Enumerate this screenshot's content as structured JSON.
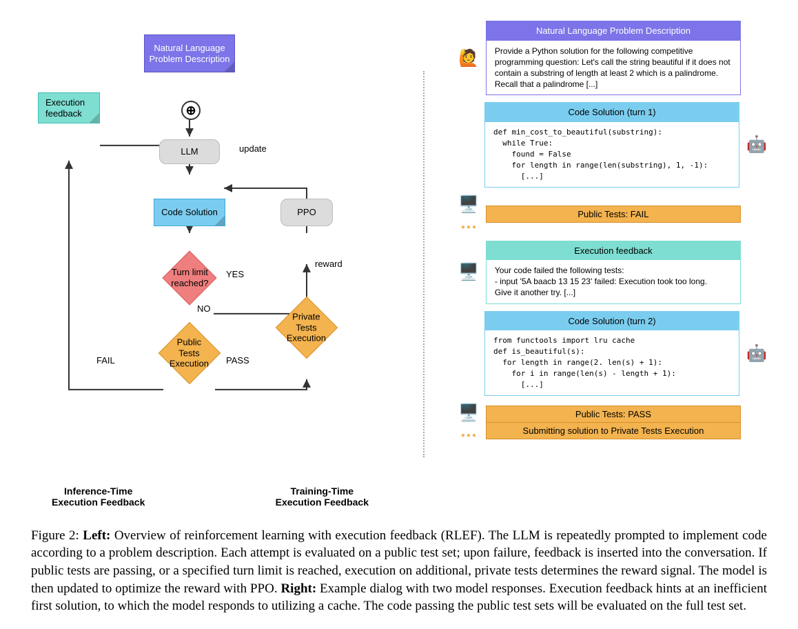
{
  "diagram": {
    "nodes": {
      "problem": "Natural Language\nProblem Description",
      "exec_feedback": "Execution\nfeedback",
      "llm": "LLM",
      "code_solution": "Code Solution",
      "ppo": "PPO",
      "turn_limit": "Turn limit\nreached?",
      "public_tests": "Public Tests\nExecution",
      "private_tests": "Private Tests\nExecution"
    },
    "edge_labels": {
      "update": "update",
      "yes": "YES",
      "no": "NO",
      "pass": "PASS",
      "fail": "FAIL",
      "reward": "reward"
    },
    "bottom": {
      "left": "Inference-Time\nExecution Feedback",
      "right": "Training-Time\nExecution Feedback"
    }
  },
  "dialog": {
    "problem_head": "Natural Language Problem Description",
    "problem_body": "Provide a Python solution for the following competitive programming question: Let's call the string beautiful if it does not contain a substring of length at least 2 which is a palindrome. Recall that a palindrome [...]",
    "turn1_head": "Code Solution (turn 1)",
    "turn1_code": "def min_cost_to_beautiful(substring):\n  while True:\n    found = False\n    for length in range(len(substring), 1, -1):\n      [...]",
    "public_fail": "Public Tests: FAIL",
    "feedback_head": "Execution feedback",
    "feedback_body": "Your code failed the following tests:\n- input '5A baacb 13 15 23' failed: Execution took too long.\nGive it another try. [...]",
    "turn2_head": "Code Solution (turn 2)",
    "turn2_code": "from functools import lru cache\ndef is_beautiful(s):\n  for length in range(2. len(s) + 1):\n    for i in range(len(s) - length + 1):\n      [...]",
    "public_pass": "Public Tests: PASS",
    "submit": "Submitting solution to Private Tests Execution"
  },
  "icons": {
    "user": "🙋",
    "robot": "🤖",
    "monitor": "🖥️"
  },
  "caption": {
    "label": "Figure 2:",
    "left_bold": "Left:",
    "left_text": " Overview of reinforcement learning with execution feedback (RLEF). The LLM is repeatedly prompted to implement code according to a problem description. Each attempt is evaluated on a public test set; upon failure, feedback is inserted into the conversation. If public tests are passing, or a specified turn limit is reached, execution on additional, private tests determines the reward signal. The model is then updated to optimize the reward with PPO. ",
    "right_bold": "Right:",
    "right_text": " Example dialog with two model responses. Execution feedback hints at an inefficient first solution, to which the model responds to utilizing a cache. The code passing the public test sets will be evaluated on the full test set."
  }
}
